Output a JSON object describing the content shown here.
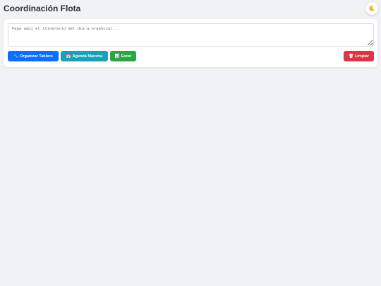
{
  "header": {
    "title": "Coordinación Flota",
    "theme_toggle_icon": "moon-icon"
  },
  "itinerary": {
    "placeholder": "Pega aquí el itinerario del día a organizar...",
    "value": ""
  },
  "actions": {
    "organize": {
      "icon": "wrench-icon",
      "glyph": "🔧",
      "label": "Organizar Tablero",
      "color": "#0d6efd"
    },
    "agenda": {
      "icon": "calendar-icon",
      "glyph": "📅",
      "label": "Agenda Maestra",
      "color": "#17a2b8"
    },
    "excel": {
      "icon": "spreadsheet-icon",
      "glyph": "📊",
      "label": "Excel",
      "color": "#28a745"
    },
    "clear": {
      "icon": "trash-icon",
      "glyph": "🗑",
      "label": "Limpiar",
      "color": "#dc3545"
    }
  },
  "colors": {
    "background": "#f0f2f5",
    "card": "#ffffff",
    "title_text": "#2b2f33"
  }
}
